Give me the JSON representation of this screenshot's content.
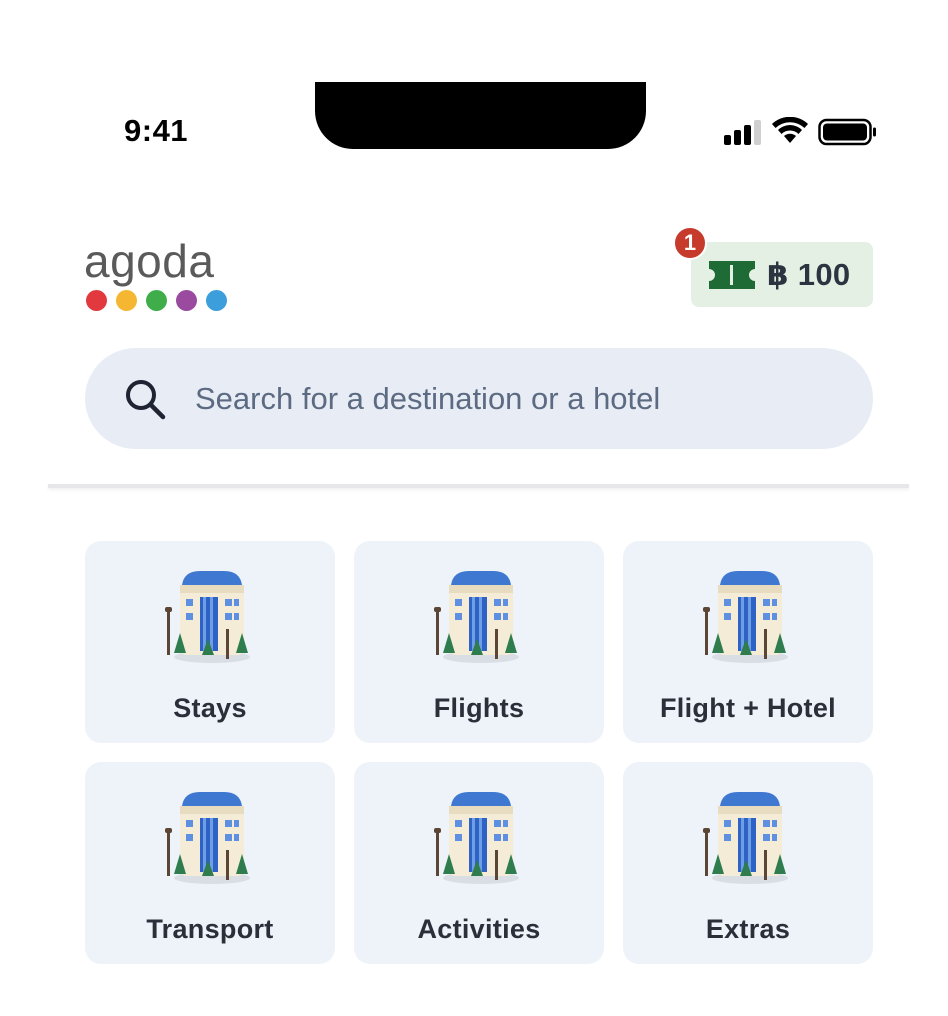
{
  "status_bar": {
    "time": "9:41",
    "icons": [
      "signal-icon",
      "wifi-icon",
      "battery-icon"
    ]
  },
  "header": {
    "logo_text": "agoda",
    "logo_dot_colors": [
      "#e2393f",
      "#f5b731",
      "#3fae4a",
      "#9a4b9f",
      "#3c9edb"
    ],
    "reward": {
      "badge_count": "1",
      "amount": "฿ 100",
      "icon": "ticket-icon",
      "accent_color": "#1f6b35"
    }
  },
  "search": {
    "placeholder": "Search for a destination or a hotel",
    "icon": "search-icon"
  },
  "categories": [
    {
      "label": "Stays",
      "icon": "hotel-building-icon"
    },
    {
      "label": "Flights",
      "icon": "hotel-building-icon"
    },
    {
      "label": "Flight + Hotel",
      "icon": "hotel-building-icon"
    },
    {
      "label": "Transport",
      "icon": "hotel-building-icon"
    },
    {
      "label": "Activities",
      "icon": "hotel-building-icon"
    },
    {
      "label": "Extras",
      "icon": "hotel-building-icon"
    }
  ]
}
